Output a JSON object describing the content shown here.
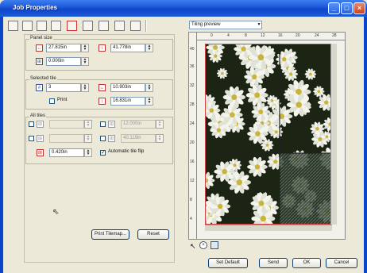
{
  "window": {
    "title": "Job Properties"
  },
  "panel_size": {
    "label": "Panel size",
    "width": "27.815in",
    "height": "41.778in",
    "overlap": "0.000in"
  },
  "selected_tile": {
    "label": "Selected tile",
    "number": "3",
    "width": "10.903in",
    "height": "16.831in",
    "print_label": "Print"
  },
  "all_tiles": {
    "label": "All tiles",
    "col_value": "12.000in",
    "row_value": "40.119in",
    "margin": "0.420in",
    "auto_flip_label": "Automatic tile flip"
  },
  "buttons": {
    "print_tilemap": "Print Tilemap...",
    "reset": "Reset",
    "set_default": "Set Default",
    "send": "Send",
    "ok": "OK",
    "cancel": "Cancel"
  },
  "preview": {
    "selected": "Tiling preview",
    "ruler_top": [
      "0",
      "4",
      "8",
      "12",
      "16",
      "20",
      "24",
      "28"
    ],
    "ruler_left": [
      "40",
      "36",
      "32",
      "28",
      "24",
      "20",
      "16",
      "12",
      "8",
      "4"
    ]
  }
}
